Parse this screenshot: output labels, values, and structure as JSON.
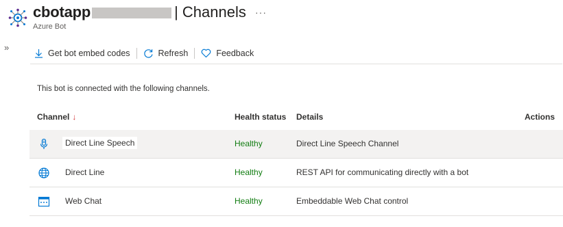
{
  "header": {
    "app_name": "cbotapp",
    "separator": "|",
    "page_title": "Channels",
    "subtitle": "Azure Bot",
    "more_label": "···"
  },
  "toolbar": {
    "embed_label": "Get bot embed codes",
    "refresh_label": "Refresh",
    "feedback_label": "Feedback"
  },
  "intro": "This bot is connected with the following channels.",
  "table": {
    "headers": {
      "channel": "Channel",
      "sort_arrow": "↓",
      "health": "Health status",
      "details": "Details",
      "actions": "Actions"
    },
    "rows": [
      {
        "icon": "microphone-icon",
        "name": "Direct Line Speech",
        "health": "Healthy",
        "details": "Direct Line Speech Channel"
      },
      {
        "icon": "globe-icon",
        "name": "Direct Line",
        "health": "Healthy",
        "details": "REST API for communicating directly with a bot"
      },
      {
        "icon": "web-chat-icon",
        "name": "Web Chat",
        "health": "Healthy",
        "details": "Embeddable Web Chat control"
      }
    ]
  },
  "colors": {
    "accent": "#0078d4",
    "healthy": "#107c10",
    "sort_arrow": "#d13438",
    "selected_row": "#f3f2f1"
  }
}
